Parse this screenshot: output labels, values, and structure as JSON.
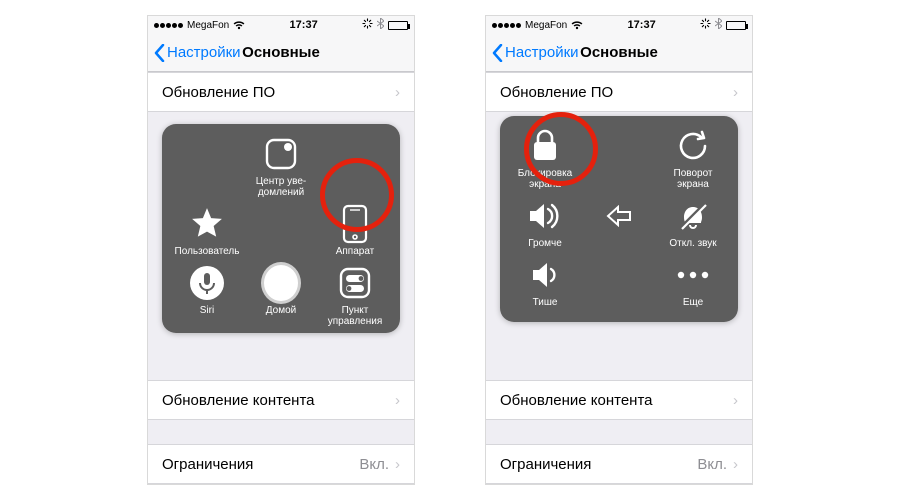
{
  "statusbar": {
    "carrier": "MegaFon",
    "time": "17:37"
  },
  "nav": {
    "back": "Настройки",
    "title": "Основные"
  },
  "rows": {
    "update": "Обновление ПО",
    "content_update": "Обновление контента",
    "restrictions": "Ограничения",
    "restrictions_value": "Вкл."
  },
  "panel1": {
    "notif": "Центр уве-\nдомлений",
    "user": "Пользователь",
    "device": "Аппарат",
    "siri": "Siri",
    "home": "Домой",
    "control": "Пункт\nуправления"
  },
  "panel2": {
    "lock": "Блокировка\nэкрана",
    "rotate": "Поворот\nэкрана",
    "louder": "Громче",
    "mute": "Откл. звук",
    "quieter": "Тише",
    "more": "Еще"
  }
}
